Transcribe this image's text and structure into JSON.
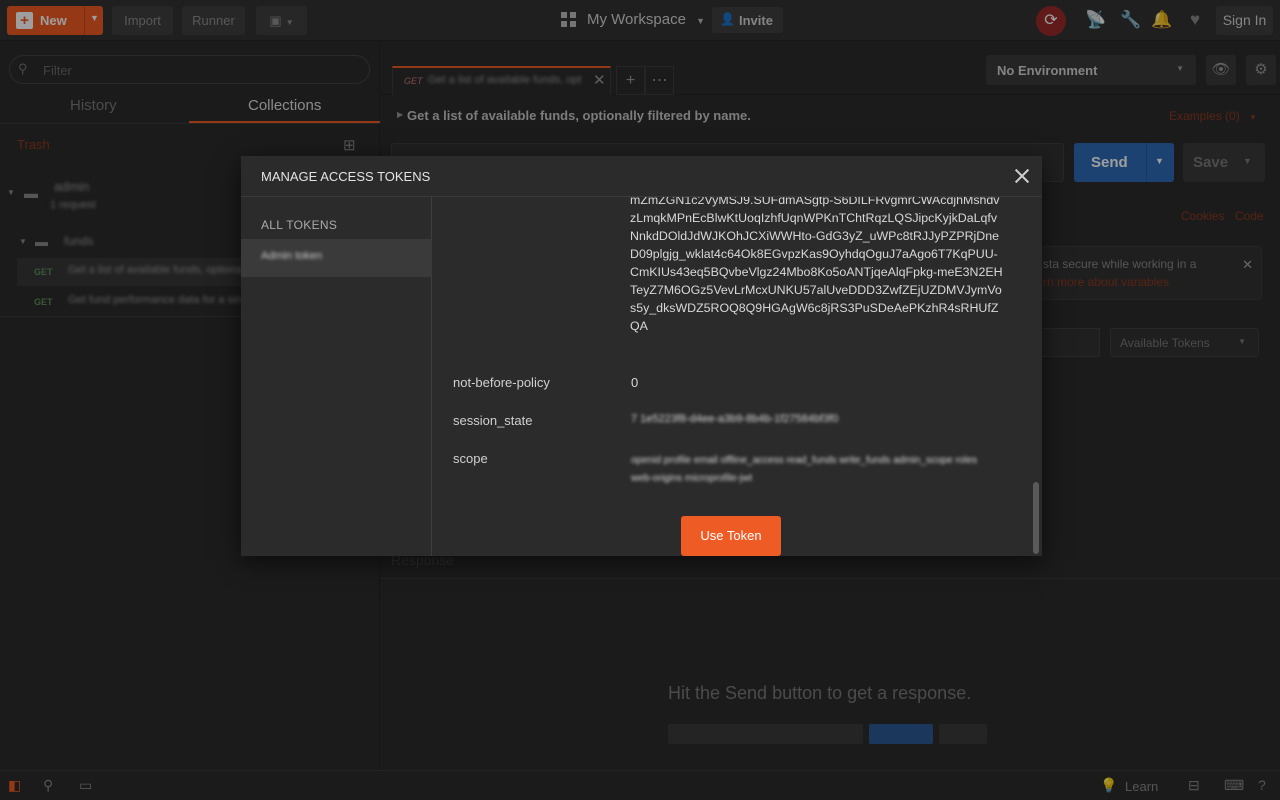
{
  "topbar": {
    "new_label": "New",
    "import_label": "Import",
    "runner_label": "Runner",
    "workspace_label": "My Workspace",
    "invite_label": "Invite",
    "signin_label": "Sign In"
  },
  "sidebar": {
    "filter_placeholder": "Filter",
    "tabs": [
      {
        "label": "History"
      },
      {
        "label": "Collections"
      }
    ],
    "trash_label": "Trash",
    "collection": {
      "name": "admin",
      "sub": "1 request"
    },
    "folder": {
      "name": "funds"
    },
    "requests": [
      {
        "method": "GET",
        "name": "Get a list of available funds, optionally filtered by name."
      },
      {
        "method": "GET",
        "name": "Get fund performance data for a single fund"
      }
    ]
  },
  "request": {
    "tab_method": "GET",
    "tab_name": "Get a list of available funds, opt",
    "description": "Get a list of available funds, optionally filtered by name.",
    "examples_label": "Examples (0)",
    "send_label": "Send",
    "save_label": "Save",
    "cookies_label": "Cookies",
    "code_label": "Code",
    "info_text_1": "sta secure while working in a",
    "info_text_2": "rn more about variables",
    "available_tokens_label": "Available Tokens",
    "response_label": "Response",
    "hint": "Hit the Send button to get a response."
  },
  "environment": {
    "selected": "No Environment"
  },
  "modal": {
    "title": "MANAGE ACCESS TOKENS",
    "all_tokens_label": "ALL TOKENS",
    "token_name": "Admin token",
    "token_value": "mZmZGN1c2VyMSJ9.SUFdmASgtp-S6DILFRvgmrCWAcdjhMshdvzLmqkMPnEcBlwKtUoqIzhfUqnWPKnTChtRqzLQSJipcKyjkDaLqfvNnkdDOldJdWJKOhJCXiWWHto-GdG3yZ_uWPc8tRJJyPZPRjDneD09plgjg_wklat4c64Ok8EGvpzKas9OyhdqOguJ7aAgo6T7KqPUU-CmKIUs43eq5BQvbeVlgz24Mbo8Ko5oANTjqeAlqFpkg-meE3N2EHTeyZ7M6OGz5VevLrMcxUNKU57alUveDDD3ZwfZEjUZDMVJymVos5y_dksWDZ5ROQ8Q9HGAgW6c8jRS3PuSDeAePKzhR4sRHUfZQA",
    "fields": [
      {
        "key": "not-before-policy",
        "value": "0"
      },
      {
        "key": "session_state",
        "value": "7 1e5223f8-d4ee-a3b9-8b4b-1f27584bf3f0"
      },
      {
        "key": "scope",
        "value": "openid profile email offline_access read_funds write_funds admin_scope roles web-origins microprofile-jwt"
      }
    ],
    "use_token_label": "Use Token"
  },
  "statusbar": {
    "learn_label": "Learn"
  },
  "colors": {
    "accent": "#ef5b25",
    "send_blue": "#2e6bb8",
    "background": "#2c2c2c"
  }
}
